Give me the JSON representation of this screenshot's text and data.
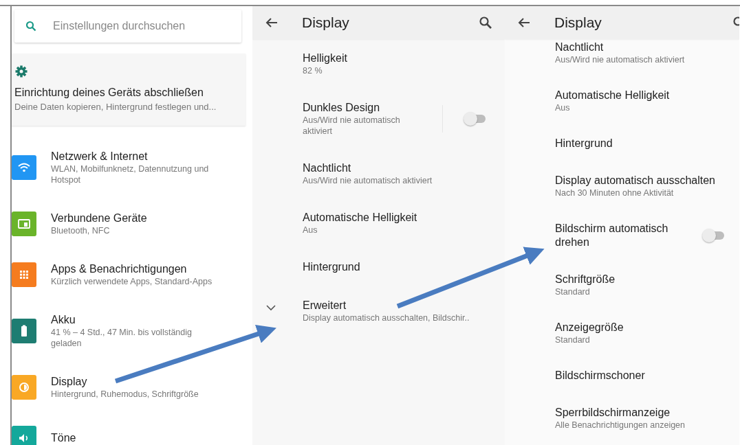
{
  "settings": {
    "search": {
      "placeholder": "Einstellungen durchsuchen"
    },
    "setup_card": {
      "title": "Einrichtung deines Geräts abschließen",
      "subtitle": "Deine Daten kopieren, Hintergrund festlegen und..."
    },
    "items": [
      {
        "title": "Netzwerk & Internet",
        "subtitle": "WLAN, Mobilfunknetz, Datennutzung und Hotspot",
        "color": "#2196f3"
      },
      {
        "title": "Verbundene Geräte",
        "subtitle": "Bluetooth, NFC",
        "color": "#6ab42a"
      },
      {
        "title": "Apps & Benachrichtigungen",
        "subtitle": "Kürzlich verwendete Apps, Standard-Apps",
        "color": "#f57c1f"
      },
      {
        "title": "Akku",
        "subtitle": "41 % – 4 Std., 47 Min. bis vollständig geladen",
        "color": "#1e7d72"
      },
      {
        "title": "Display",
        "subtitle": "Hintergrund, Ruhemodus, Schriftgröße",
        "color": "#f9a825"
      },
      {
        "title": "Töne",
        "color": "#14a89b"
      }
    ]
  },
  "panels": [
    {
      "title": "Display",
      "items": [
        {
          "kind": "plain",
          "title": "Helligkeit",
          "subtitle": "82 %"
        },
        {
          "kind": "toggle",
          "title": "Dunkles Design",
          "subtitle": "Aus/Wird nie automatisch aktiviert",
          "on": false
        },
        {
          "kind": "plain",
          "title": "Nachtlicht",
          "subtitle": "Aus/Wird nie automatisch aktiviert"
        },
        {
          "kind": "plain",
          "title": "Automatische Helligkeit",
          "subtitle": "Aus"
        },
        {
          "kind": "plain",
          "title": "Hintergrund"
        },
        {
          "kind": "expand",
          "title": "Erweitert",
          "subtitle": "Display automatisch ausschalten, Bildschir..",
          "expanded": false
        }
      ]
    },
    {
      "title": "Display",
      "items": [
        {
          "kind": "plain",
          "title": "Nachtlicht",
          "subtitle": "Aus/Wird nie automatisch aktiviert"
        },
        {
          "kind": "plain",
          "title": "Automatische Helligkeit",
          "subtitle": "Aus"
        },
        {
          "kind": "plain",
          "title": "Hintergrund"
        },
        {
          "kind": "plain",
          "title": "Display automatisch ausschalten",
          "subtitle": "Nach 30 Minuten ohne Aktivität"
        },
        {
          "kind": "toggle",
          "title": "Bildschirm automatisch drehen",
          "on": false
        },
        {
          "kind": "plain",
          "title": "Schriftgröße",
          "subtitle": "Standard"
        },
        {
          "kind": "plain",
          "title": "Anzeigegröße",
          "subtitle": "Standard"
        },
        {
          "kind": "plain",
          "title": "Bildschirmschoner"
        },
        {
          "kind": "plain",
          "title": "Sperrbildschirmanzeige",
          "subtitle": "Alle Benachrichtigungen anzeigen"
        }
      ]
    }
  ]
}
